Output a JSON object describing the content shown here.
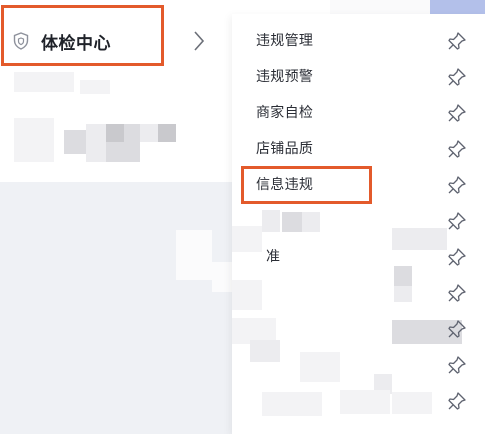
{
  "sidebar": {
    "section_title": "体检中心",
    "icon": "shield-icon",
    "expand_icon": "chevron-right-icon"
  },
  "submenu": {
    "items": [
      {
        "label": "违规管理",
        "pin_icon": "pin-icon"
      },
      {
        "label": "违规预警",
        "pin_icon": "pin-icon"
      },
      {
        "label": "商家自检",
        "pin_icon": "pin-icon"
      },
      {
        "label": "店铺品质",
        "pin_icon": "pin-icon"
      },
      {
        "label": "信息违规",
        "pin_icon": "pin-icon"
      },
      {
        "label": "",
        "pin_icon": "pin-icon"
      },
      {
        "label": "准",
        "pin_icon": "pin-icon"
      },
      {
        "label": "",
        "pin_icon": "pin-icon"
      },
      {
        "label": "",
        "pin_icon": "pin-icon"
      },
      {
        "label": "",
        "pin_icon": "pin-icon"
      },
      {
        "label": "",
        "pin_icon": "pin-icon"
      }
    ]
  },
  "colors": {
    "highlight_border": "#e35a2b",
    "text": "#2a2d35",
    "pin_icon": "#5f6370",
    "content_background": "#eff1f5",
    "accent": "#b3c0ea"
  }
}
